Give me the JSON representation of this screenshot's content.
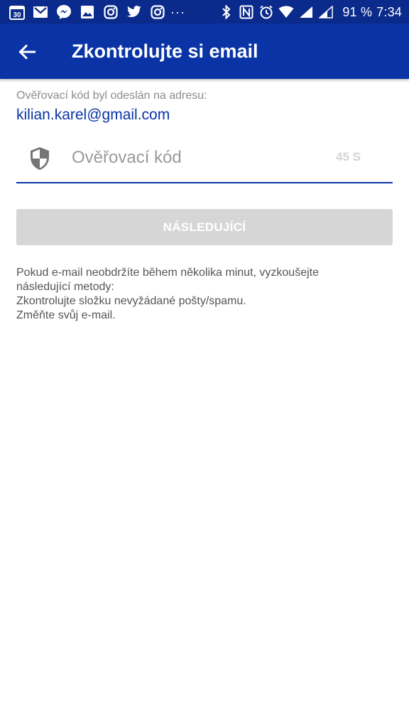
{
  "status_bar": {
    "left_icons": [
      "calendar-icon",
      "gmail-icon",
      "messenger-icon",
      "image-icon",
      "instagram-icon",
      "twitter-icon",
      "instagram-icon"
    ],
    "calendar_day": "30",
    "more": "···",
    "right_icons": [
      "bluetooth-icon",
      "nfc-icon",
      "alarm-icon",
      "wifi-icon",
      "signal-icon",
      "signal-icon"
    ],
    "battery": "91 %",
    "time": "7:34"
  },
  "app_bar": {
    "title": "Zkontrolujte si email",
    "back_icon": "arrow-left-icon"
  },
  "content": {
    "sent_label": "Ověřovací kód byl odeslán na adresu:",
    "email": "kilian.karel@gmail.com",
    "code_field": {
      "placeholder": "Ověřovací kód",
      "value": "",
      "timer": "45 S",
      "icon": "shield-icon"
    },
    "next_button": "NÁSLEDUJÍCÍ",
    "help_lines": [
      "Pokud e-mail neobdržíte během několika minut, vyzkoušejte",
      "následující metody:",
      "Zkontrolujte složku nevyžádané pošty/spamu.",
      "Změňte svůj e-mail."
    ]
  },
  "colors": {
    "status_bar": "#0a2a8c",
    "app_bar": "#0a34a6",
    "accent": "#0a34a6",
    "disabled_button": "#d6d6d6"
  }
}
